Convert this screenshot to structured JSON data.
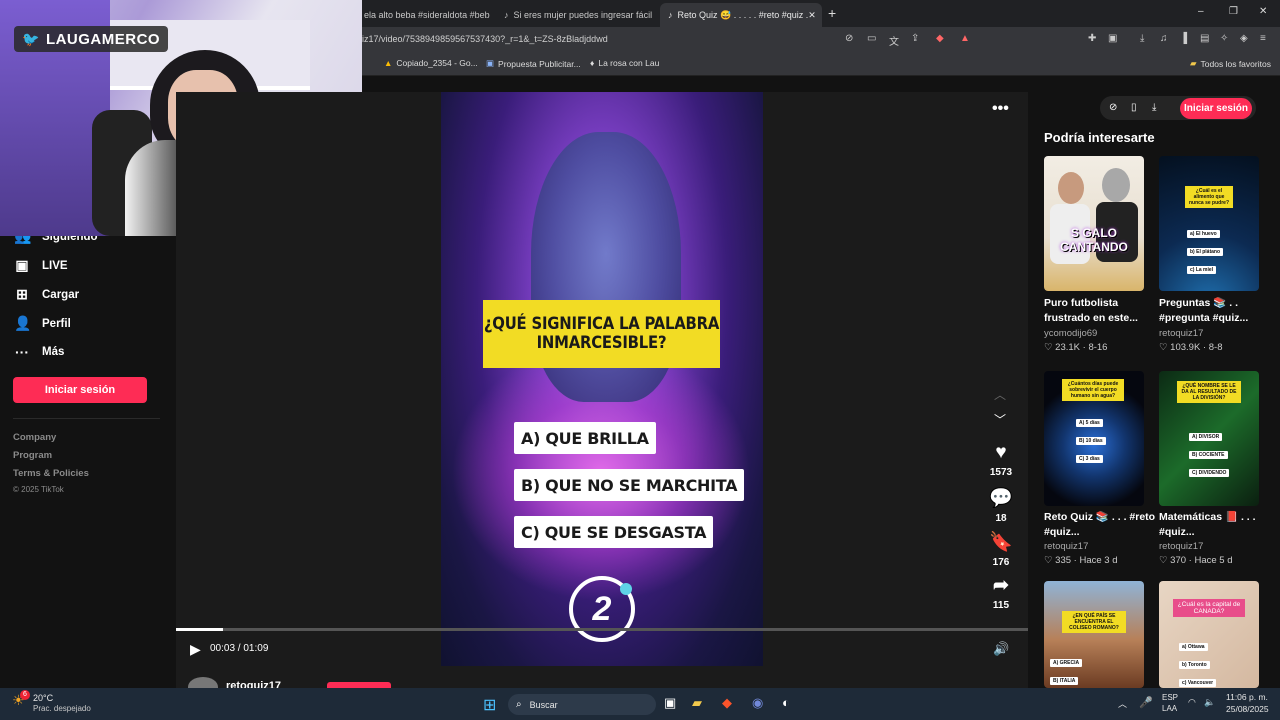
{
  "browser": {
    "tabs": [
      {
        "label": "ela alto beba #sideraldota #bebaa"
      },
      {
        "label": "Si eres mujer puedes ingresar fácil a"
      },
      {
        "label": "Reto Quiz 😅 . . . . . #reto #quiz ."
      }
    ],
    "new_tab": "+",
    "url": "iz17/video/7538949859567537430?_r=1&_t=ZS-8zBladjddwd",
    "bookmarks": [
      "Copiado_2354 - Go...",
      "Propuesta Publicitar...",
      "La rosa con Lau"
    ],
    "all_bookmarks": "Todos los favoritos",
    "window_controls": [
      "‒",
      "❐",
      "✕"
    ]
  },
  "stream": {
    "handle": "LAUGAMERCO"
  },
  "sidebar": {
    "items": [
      {
        "label": "Siguiendo",
        "icon": "following-icon"
      },
      {
        "label": "LIVE",
        "icon": "live-icon"
      },
      {
        "label": "Cargar",
        "icon": "upload-icon"
      },
      {
        "label": "Perfil",
        "icon": "profile-icon"
      },
      {
        "label": "Más",
        "icon": "more-icon"
      }
    ],
    "login_button": "Iniciar sesión",
    "footer": [
      "Company",
      "Program",
      "Terms & Policies",
      "© 2025 TikTok"
    ]
  },
  "video": {
    "question": "¿QUÉ SIGNIFICA LA PALABRA INMARCESIBLE?",
    "answers": [
      "A) QUE BRILLA",
      "B) QUE NO SE MARCHITA",
      "C) QUE SE DESGASTA"
    ],
    "countdown": "2",
    "current_time": "00:03",
    "duration": "01:09",
    "progress": 0.055,
    "actions": {
      "likes": "1573",
      "comments": "18",
      "saves": "176",
      "shares": "115"
    },
    "author": "retoquiz17"
  },
  "right_panel": {
    "login_button": "Iniciar sesión",
    "title": "Podría interesarte",
    "cards": [
      {
        "title": "Puro futbolista frustrado en este...",
        "user": "ycomodijo69",
        "likes": "23.1K",
        "date": "8-16",
        "overlay": "S GALO CANTANDO"
      },
      {
        "title": "Preguntas 📚 . . #pregunta #quiz...",
        "user": "retoquiz17",
        "likes": "103.9K",
        "date": "8-8",
        "overlay": "¿Cuál es el alimento que nunca se pudre?",
        "options": [
          "a) El huevo",
          "b) El plátano",
          "c) La miel"
        ]
      },
      {
        "title": "Reto Quiz 📚 . . . #reto #quiz...",
        "user": "retoquiz17",
        "likes": "335",
        "date": "Hace 3 d",
        "overlay": "¿Cuántos días puede sobrevivir el cuerpo humano sin agua?",
        "options": [
          "A) 5 días",
          "B) 10 días",
          "C) 3 días"
        ]
      },
      {
        "title": "Matemáticas 📕 . . . #quiz...",
        "user": "retoquiz17",
        "likes": "370",
        "date": "Hace 5 d",
        "overlay": "¿QUÉ NOMBRE SE LE DA AL RESULTADO DE LA DIVISIÓN?",
        "options": [
          "A) DIVISOR",
          "B) COCIENTE",
          "C) DIVIDENDO"
        ]
      },
      {
        "overlay": "¿EN QUÉ PAÍS SE ENCUENTRA EL COLISEO ROMANO?",
        "options": [
          "A) GRECIA",
          "B) ITALIA"
        ]
      },
      {
        "overlay": "¿Cuál es la capital de CANADA?",
        "options": [
          "a) Ottawa",
          "b) Toronto",
          "c) Vancouver"
        ]
      }
    ]
  },
  "taskbar": {
    "weather_temp": "20°C",
    "weather_desc": "Prac. despejado",
    "weather_badge": "6",
    "search": "Buscar",
    "lang": "ESP",
    "lang2": "LAA",
    "time": "11:06 p. m.",
    "date": "25/08/2025"
  },
  "colors": {
    "accent": "#fe2c55",
    "quiz_yellow": "#f2dc24",
    "taskbar": "#1e2a38"
  }
}
